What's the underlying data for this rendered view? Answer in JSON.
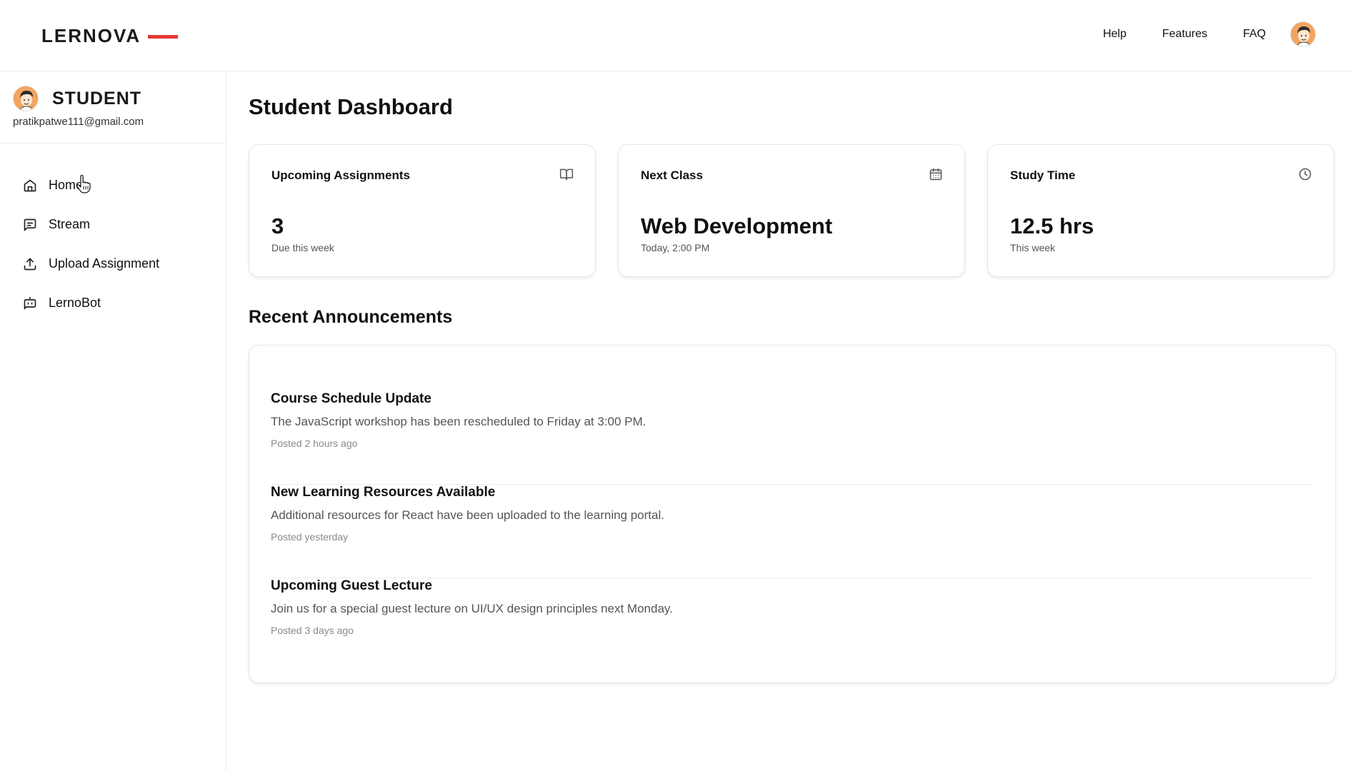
{
  "brand": {
    "name": "LERNOVA",
    "accent": "#e53935"
  },
  "topnav": {
    "items": [
      "Help",
      "Features",
      "FAQ"
    ]
  },
  "sidebar": {
    "role": "STUDENT",
    "email": "pratikpatwe111@gmail.com",
    "items": [
      {
        "label": "Home",
        "icon": "home-icon"
      },
      {
        "label": "Stream",
        "icon": "message-icon"
      },
      {
        "label": "Upload Assignment",
        "icon": "upload-icon"
      },
      {
        "label": "LernoBot",
        "icon": "bot-icon"
      }
    ]
  },
  "main": {
    "title": "Student Dashboard",
    "stats": [
      {
        "title": "Upcoming Assignments",
        "value": "3",
        "sub": "Due this week",
        "icon": "book-open-icon"
      },
      {
        "title": "Next Class",
        "value": "Web Development",
        "sub": "Today, 2:00 PM",
        "icon": "calendar-icon"
      },
      {
        "title": "Study Time",
        "value": "12.5 hrs",
        "sub": "This week",
        "icon": "clock-icon"
      }
    ],
    "announcements_title": "Recent Announcements",
    "announcements": [
      {
        "title": "Course Schedule Update",
        "body": "The JavaScript workshop has been rescheduled to Friday at 3:00 PM.",
        "time": "Posted 2 hours ago"
      },
      {
        "title": "New Learning Resources Available",
        "body": "Additional resources for React have been uploaded to the learning portal.",
        "time": "Posted yesterday"
      },
      {
        "title": "Upcoming Guest Lecture",
        "body": "Join us for a special guest lecture on UI/UX design principles next Monday.",
        "time": "Posted 3 days ago"
      }
    ]
  }
}
